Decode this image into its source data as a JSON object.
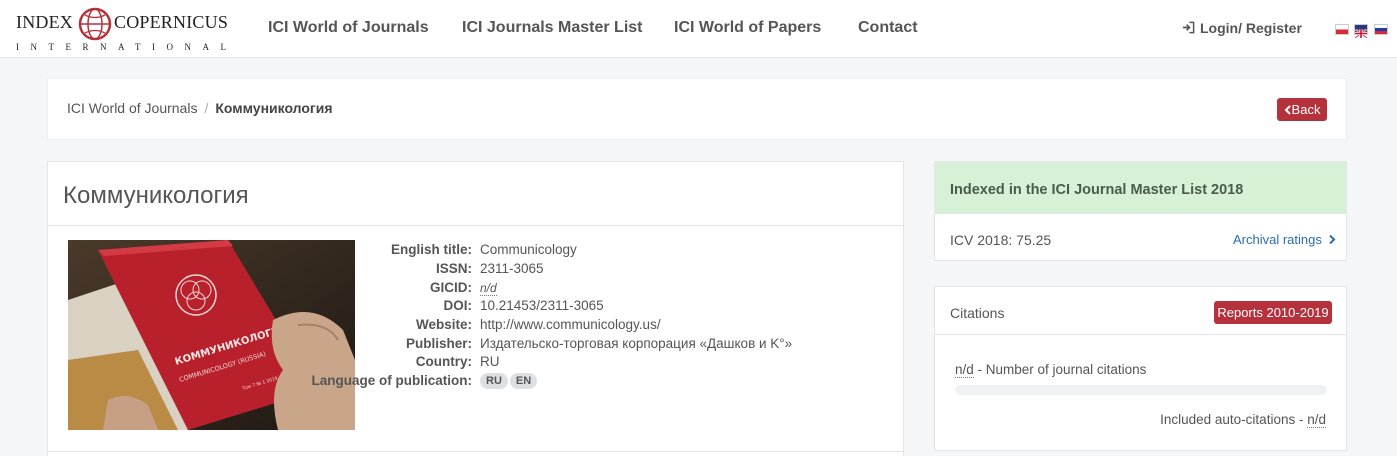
{
  "logo": {
    "left_word": "INDEX",
    "right_word": "COPERNICUS",
    "sub": "INTERNATIONAL"
  },
  "nav": {
    "items": [
      {
        "label": "ICI World of Journals"
      },
      {
        "label": "ICI Journals Master List"
      },
      {
        "label": "ICI World of Papers"
      },
      {
        "label": "Contact"
      }
    ],
    "login": "Login/ Register",
    "languages": [
      "pl",
      "en",
      "ru"
    ]
  },
  "breadcrumb": {
    "root": "ICI World of Journals",
    "separator": "/",
    "current": "Коммуникология",
    "back": "Back"
  },
  "journal": {
    "title": "Коммуникология",
    "fields": [
      {
        "label": "English title:",
        "value": "Communicology"
      },
      {
        "label": "ISSN:",
        "value": "2311-3065"
      },
      {
        "label": "GICID:",
        "value": "n/d"
      },
      {
        "label": "DOI:",
        "value": "10.21453/2311-3065"
      },
      {
        "label": "Website:",
        "value": "http://www.communicology.us/"
      },
      {
        "label": "Publisher:",
        "value": "Издательско-торговая корпорация «Дашков и K°»"
      },
      {
        "label": "Country:",
        "value": "RU"
      },
      {
        "label": "Language of publication:",
        "value": ""
      }
    ],
    "languages": [
      "RU",
      "EN"
    ],
    "cover": {
      "title_ru": "КОММУНИКОЛОГИЯ",
      "subtitle": "COMMUNICOLOGY (RUSSIA)",
      "volume": "Том 7 № 1 2019"
    }
  },
  "indexed": {
    "title": "Indexed in the ICI Journal Master List 2018",
    "icv": "ICV 2018: 75.25",
    "archival": "Archival ratings"
  },
  "citations": {
    "title": "Citations",
    "reports": "Reports 2010-2019",
    "count": "n/d",
    "count_label": " - Number of journal citations",
    "auto_label": "Included auto-citations - ",
    "auto_value": "n/d"
  },
  "colors": {
    "accent_red": "#b5323c",
    "link_blue": "#2a6db0",
    "indexed_green": "#d6f1d6"
  }
}
